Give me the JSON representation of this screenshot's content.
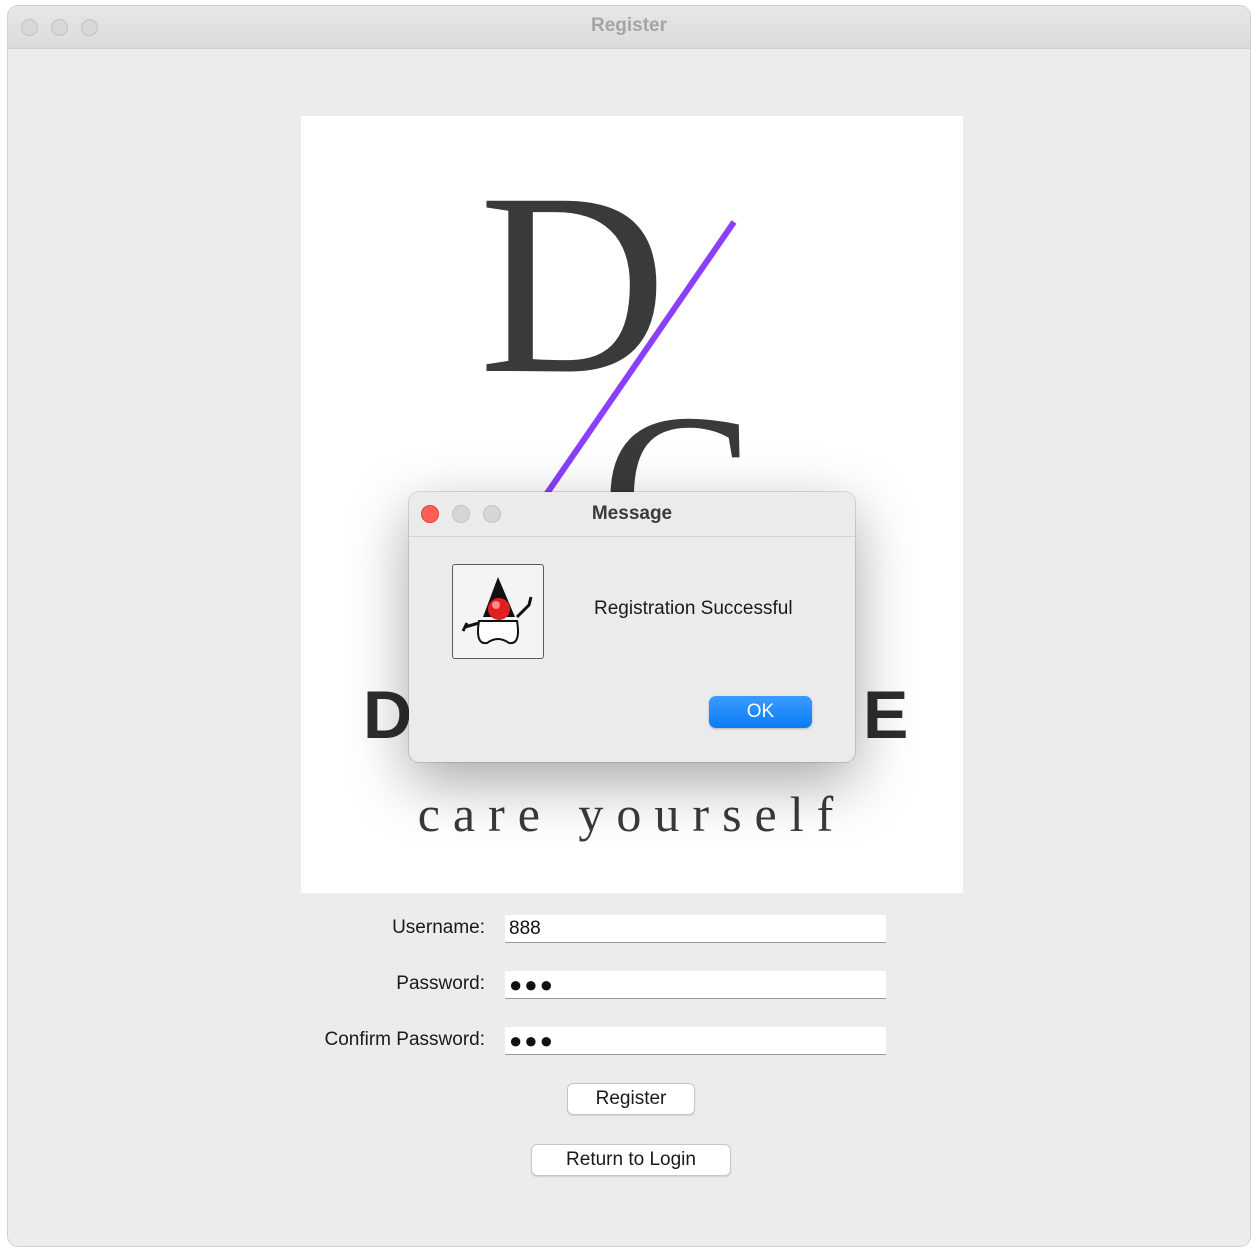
{
  "window": {
    "title": "Register"
  },
  "logo": {
    "monogram": "DC",
    "brand_left_letter": "D",
    "brand_right_letter": "E",
    "tagline": "care yourself",
    "accent_color": "#8a3ffc"
  },
  "form": {
    "username_label": "Username:",
    "username_value": "888",
    "password_label": "Password:",
    "password_value": "●●●",
    "confirm_label": "Confirm Password:",
    "confirm_value": "●●●",
    "register_button": "Register",
    "return_button": "Return to Login"
  },
  "dialog": {
    "title": "Message",
    "message": "Registration Successful",
    "ok_label": "OK",
    "icon": "java-duke-icon"
  }
}
